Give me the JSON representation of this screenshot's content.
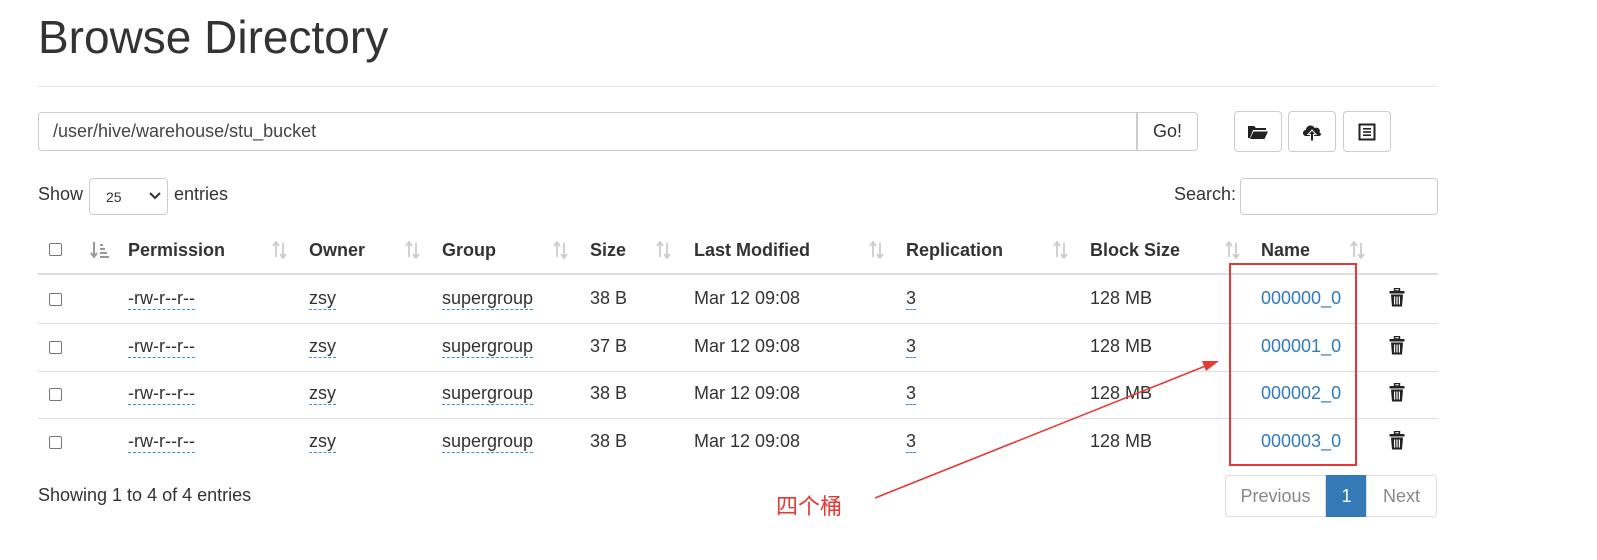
{
  "page": {
    "title": "Browse Directory"
  },
  "toolbar": {
    "path_value": "/user/hive/warehouse/stu_bucket",
    "go_label": "Go!",
    "buttons": [
      {
        "icon": "folder-open-icon"
      },
      {
        "icon": "cloud-upload-icon"
      },
      {
        "icon": "list-icon"
      }
    ]
  },
  "controls": {
    "show_label": "Show",
    "page_size": "25",
    "entries_label": "entries",
    "search_label": "Search:"
  },
  "table": {
    "columns": [
      "Permission",
      "Owner",
      "Group",
      "Size",
      "Last Modified",
      "Replication",
      "Block Size",
      "Name"
    ],
    "rows": [
      {
        "permission": "-rw-r--r--",
        "owner": "zsy",
        "group": "supergroup",
        "size": "38 B",
        "modified": "Mar 12 09:08",
        "replication": "3",
        "block_size": "128 MB",
        "name": "000000_0"
      },
      {
        "permission": "-rw-r--r--",
        "owner": "zsy",
        "group": "supergroup",
        "size": "37 B",
        "modified": "Mar 12 09:08",
        "replication": "3",
        "block_size": "128 MB",
        "name": "000001_0"
      },
      {
        "permission": "-rw-r--r--",
        "owner": "zsy",
        "group": "supergroup",
        "size": "38 B",
        "modified": "Mar 12 09:08",
        "replication": "3",
        "block_size": "128 MB",
        "name": "000002_0"
      },
      {
        "permission": "-rw-r--r--",
        "owner": "zsy",
        "group": "supergroup",
        "size": "38 B",
        "modified": "Mar 12 09:08",
        "replication": "3",
        "block_size": "128 MB",
        "name": "000003_0"
      }
    ]
  },
  "footer": {
    "info": "Showing 1 to 4 of 4 entries",
    "previous": "Previous",
    "current_page": "1",
    "next": "Next"
  },
  "annotation": {
    "text": "四个桶",
    "color": "#e53935"
  },
  "colors": {
    "link": "#337ab7",
    "accent": "#337ab7",
    "annotation": "#e53935"
  }
}
